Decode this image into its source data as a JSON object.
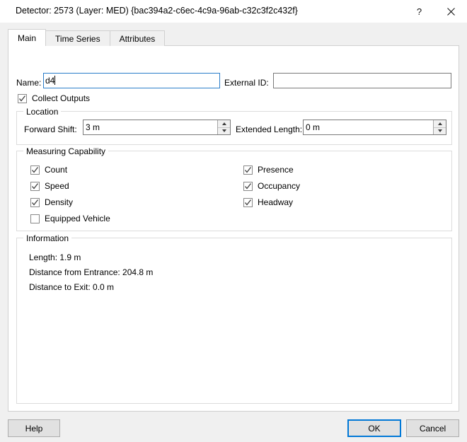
{
  "window": {
    "title": "Detector: 2573 (Layer: MED) {bac394a2-c6ec-4c9a-96ab-c32c3f2c432f}",
    "help_icon": "question-mark-icon",
    "close_icon": "close-icon",
    "help_glyph": "?",
    "close_glyph": "×"
  },
  "colors": {
    "accent": "#0078d7",
    "focus_border": "#2a7dc9",
    "dialog_bg": "#f0f0f0",
    "panel_bg": "#ffffff",
    "group_border": "#dcdcdc",
    "field_border": "#7a7a7a",
    "button_face": "#e1e1e1"
  },
  "tabs": [
    {
      "label": "Main",
      "active": true
    },
    {
      "label": "Time Series",
      "active": false
    },
    {
      "label": "Attributes",
      "active": false
    }
  ],
  "main": {
    "name": {
      "label": "Name:",
      "value": "d4",
      "placeholder": "",
      "focused": true
    },
    "external_id": {
      "label": "External ID:",
      "value": "",
      "placeholder": ""
    },
    "collect_outputs": {
      "label": "Collect Outputs",
      "checked": true
    },
    "location": {
      "title": "Location",
      "forward_shift": {
        "label": "Forward Shift:",
        "value": "3 m"
      },
      "extended_length": {
        "label": "Extended Length:",
        "value": "0 m"
      }
    },
    "measuring_capability": {
      "title": "Measuring Capability",
      "left_column": [
        {
          "label": "Count",
          "checked": true
        },
        {
          "label": "Speed",
          "checked": true
        },
        {
          "label": "Density",
          "checked": true
        },
        {
          "label": "Equipped Vehicle",
          "checked": false
        }
      ],
      "right_column": [
        {
          "label": "Presence",
          "checked": true
        },
        {
          "label": "Occupancy",
          "checked": true
        },
        {
          "label": "Headway",
          "checked": true
        }
      ]
    },
    "information": {
      "title": "Information",
      "lines": [
        "Length: 1.9 m",
        "Distance from Entrance: 204.8 m",
        "Distance to Exit: 0.0 m"
      ]
    }
  },
  "footer": {
    "help": "Help",
    "ok": "OK",
    "cancel": "Cancel"
  }
}
